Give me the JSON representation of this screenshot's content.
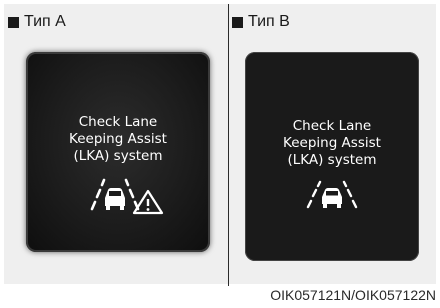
{
  "type_a": {
    "label": "Тип A",
    "message": [
      "Check Lane",
      "Keeping Assist",
      "(LKA) system"
    ]
  },
  "type_b": {
    "label": "Тип B",
    "message": [
      "Check Lane",
      "Keeping Assist",
      "(LKA) system"
    ]
  },
  "caption": "OIK057121N/OIK057122N",
  "icons": {
    "lka_icon": "lane-keeping-car-icon",
    "warning_icon": "warning-triangle-icon"
  },
  "colors": {
    "screen_bg": "#1a1a1a",
    "screen_text": "#ffffff"
  }
}
